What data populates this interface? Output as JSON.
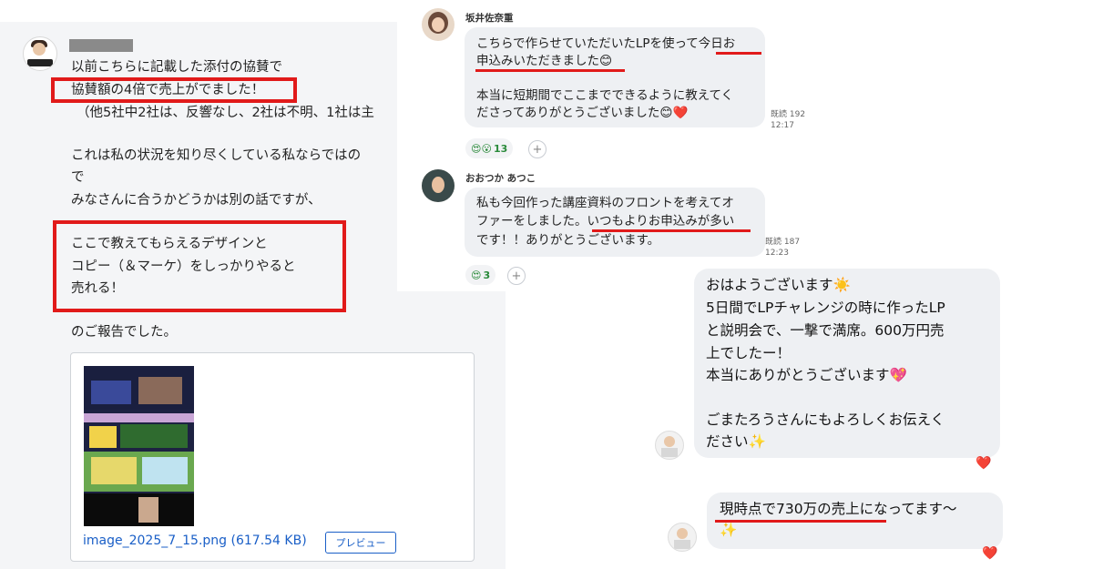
{
  "left_post": {
    "lines": [
      "以前こちらに記載した添付の協賛で",
      "協賛額の4倍で売上がでました！",
      "（他5社中2社は、反響なし、2社は不明、1社は主",
      "これは私の状況を知り尽くしている私ならではの",
      "で",
      "みなさんに合うかどうかは別の話ですが、",
      "ここで教えてもらえるデザインと",
      "コピー（＆マーケ）をしっかりやると",
      "売れる！",
      "のご報告でした。"
    ],
    "attachment": {
      "filename": "image_2025_7_15.png (617.54 KB)",
      "preview_label": "プレビュー"
    }
  },
  "chat_top": {
    "messages": [
      {
        "sender": "坂井佐奈重",
        "lines": [
          "こちらで作らせていただいたLPを使って今日お",
          "申込みいただきました😊",
          "",
          "本当に短期間でここまでできるように教えてく",
          "ださってありがとうございました😊❤️"
        ],
        "read": "既読 192",
        "time": "12:17",
        "reaction_emojis": "😍😮",
        "reaction_count": "13"
      },
      {
        "sender": "おおつか あつこ",
        "lines": [
          "私も今回作った講座資料のフロントを考えてオ",
          "ファーをしました。いつもよりお申込みが多い",
          "です！！ありがとうございます。"
        ],
        "read": "既読 187",
        "time": "12:23",
        "reaction_emojis": "😍",
        "reaction_count": "3"
      }
    ],
    "plus_label": "+"
  },
  "chat_bottom": {
    "message1_lines": [
      "おはようございます☀️",
      "5日間でLPチャレンジの時に作ったLP",
      "と説明会で、一撃で満席。600万円売",
      "上でしたー！",
      "本当にありがとうございます💖",
      "",
      "ごまたろうさんにもよろしくお伝えく",
      "ださい✨"
    ],
    "message2_lines": [
      "現時点で730万の売上になってます〜",
      "✨"
    ],
    "heart": "❤️"
  },
  "colors": {
    "highlight_red": "#e11a1a",
    "bubble_gray": "#eef0f3",
    "link_blue": "#1a5fc7"
  }
}
